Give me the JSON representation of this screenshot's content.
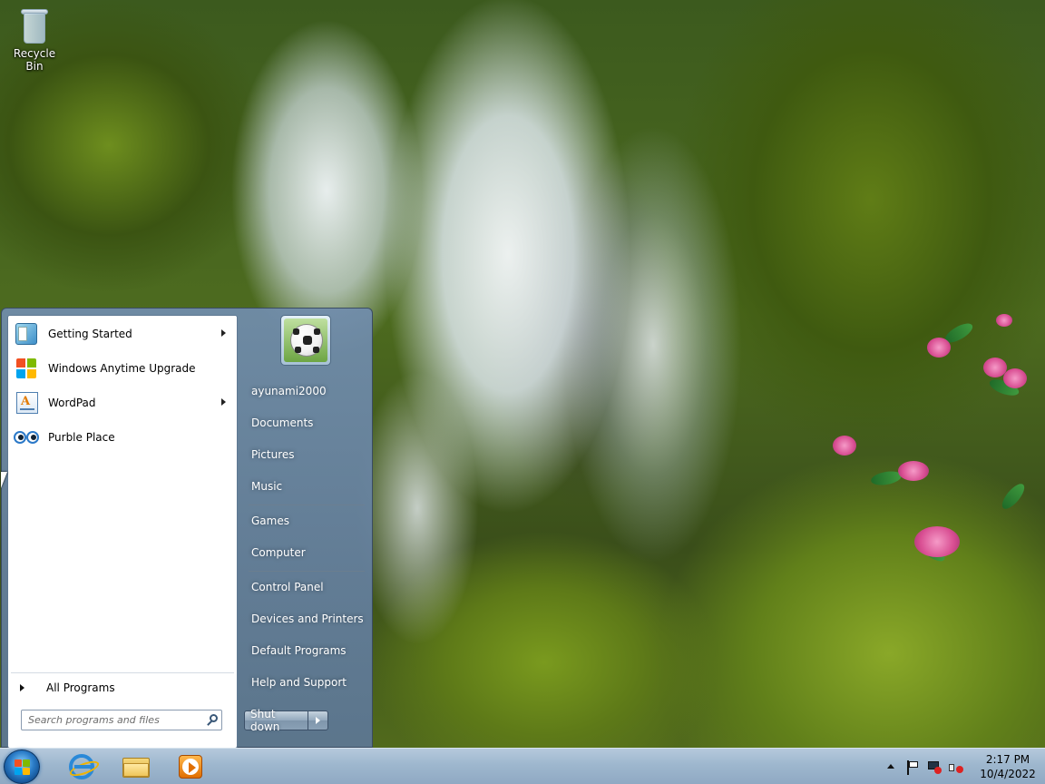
{
  "desktop": {
    "icons": [
      {
        "label": "Recycle Bin",
        "icon": "recycle-bin-icon"
      }
    ]
  },
  "start_menu": {
    "programs": [
      {
        "label": "Getting Started",
        "icon": "getting-started-icon",
        "has_submenu": true
      },
      {
        "label": "Windows Anytime Upgrade",
        "icon": "windows-flag-icon",
        "has_submenu": false
      },
      {
        "label": "WordPad",
        "icon": "wordpad-icon",
        "has_submenu": true
      },
      {
        "label": "Purble Place",
        "icon": "purble-place-icon",
        "has_submenu": false
      }
    ],
    "all_programs_label": "All Programs",
    "search": {
      "placeholder": "Search programs and files",
      "value": ""
    },
    "user": {
      "name": "ayunami2000",
      "avatar": "soccer-ball-avatar"
    },
    "right_items_group1": [
      "Documents",
      "Pictures",
      "Music"
    ],
    "right_items_group2": [
      "Games",
      "Computer"
    ],
    "right_items_group3": [
      "Control Panel",
      "Devices and Printers",
      "Default Programs",
      "Help and Support"
    ],
    "shutdown_label": "Shut down"
  },
  "taskbar": {
    "pinned": [
      {
        "name": "Internet Explorer",
        "icon": "internet-explorer-icon"
      },
      {
        "name": "Windows Explorer",
        "icon": "folder-icon"
      },
      {
        "name": "Windows Media Player",
        "icon": "media-player-icon"
      }
    ],
    "tray": {
      "icons": [
        "show-hidden-icons",
        "action-center-flag-icon",
        "network-disconnected-icon",
        "volume-muted-icon"
      ],
      "time": "2:17 PM",
      "date": "10/4/2022"
    }
  },
  "colors": {
    "start_menu_frame": "#6f8caa",
    "taskbar": "#9eb7ce",
    "orb": "#2b7dc8"
  }
}
